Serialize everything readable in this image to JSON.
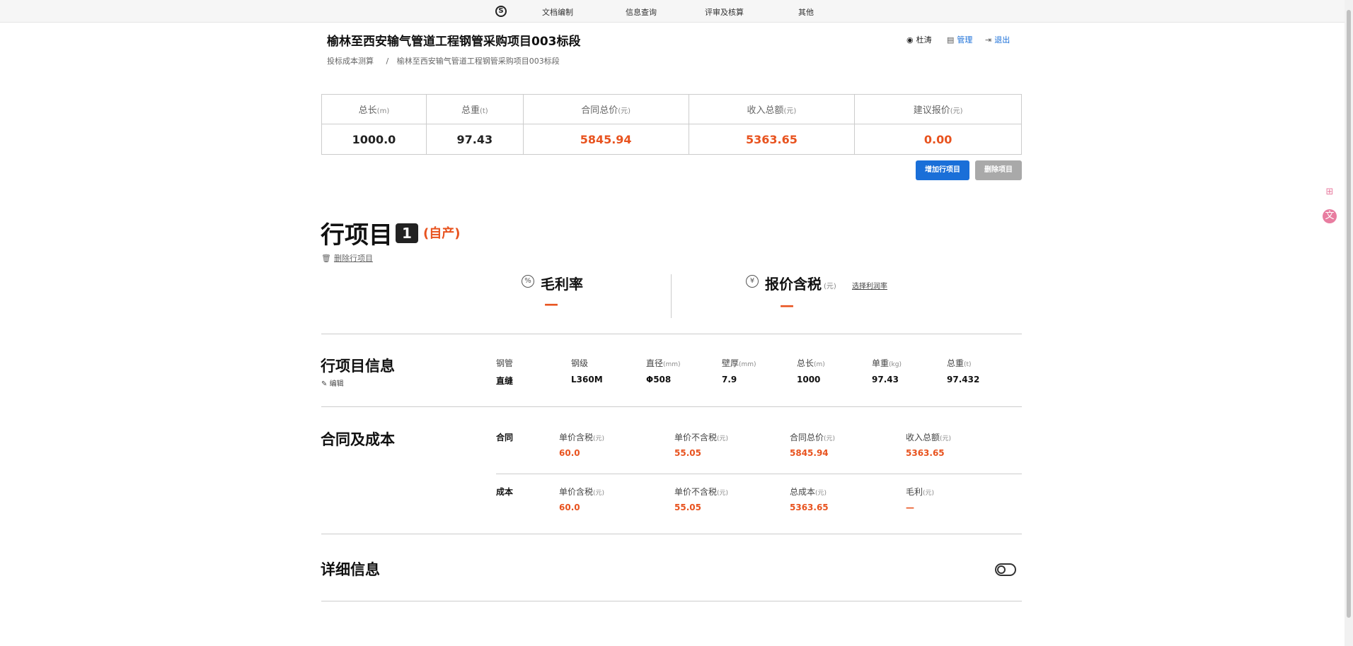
{
  "nav": {
    "logo": "S",
    "items": [
      "文档编制",
      "信息查询",
      "评审及核算",
      "其他"
    ]
  },
  "page": {
    "title": "榆林至西安输气管道工程钢管采购项目003标段",
    "breadcrumb": [
      "投标成本测算",
      "/",
      "榆林至西安输气管道工程钢管采购项目003标段"
    ]
  },
  "user": {
    "name": "杜涛",
    "manage": "管理",
    "logout": "退出"
  },
  "summary": {
    "headers": [
      {
        "label": "总长",
        "unit": "(m)"
      },
      {
        "label": "总重",
        "unit": "(t)"
      },
      {
        "label": "合同总价",
        "unit": "(元)"
      },
      {
        "label": "收入总额",
        "unit": "(元)"
      },
      {
        "label": "建议报价",
        "unit": "(元)"
      }
    ],
    "values": [
      "1000.0",
      "97.43",
      "5845.94",
      "5363.65",
      "0.00"
    ]
  },
  "buttons": {
    "add": "增加行项目",
    "delete": "删除项目"
  },
  "line_item": {
    "title": "行项目",
    "number": "1",
    "tag": "(自产)",
    "delete_label": "删除行项目",
    "gross_margin_label": "毛利率",
    "gross_margin_value": "—",
    "quote_label": "报价含税",
    "quote_unit": "(元)",
    "quote_value": "—",
    "select_rate": "选择利润率"
  },
  "info": {
    "title": "行项目信息",
    "edit": "编辑",
    "fields": [
      {
        "label": "钢管",
        "unit": "",
        "value": "直缝"
      },
      {
        "label": "钢级",
        "unit": "",
        "value": "L360M"
      },
      {
        "label": "直径",
        "unit": "(mm)",
        "value": "Φ508"
      },
      {
        "label": "壁厚",
        "unit": "(mm)",
        "value": "7.9"
      },
      {
        "label": "总长",
        "unit": "(m)",
        "value": "1000"
      },
      {
        "label": "单重",
        "unit": "(kg)",
        "value": "97.43"
      },
      {
        "label": "总重",
        "unit": "(t)",
        "value": "97.432"
      }
    ]
  },
  "contract": {
    "title": "合同及成本",
    "contract_label": "合同",
    "cost_label": "成本",
    "contract_fields": [
      {
        "label": "单价含税",
        "unit": "(元)",
        "value": "60.0"
      },
      {
        "label": "单价不含税",
        "unit": "(元)",
        "value": "55.05"
      },
      {
        "label": "合同总价",
        "unit": "(元)",
        "value": "5845.94"
      },
      {
        "label": "收入总额",
        "unit": "(元)",
        "value": "5363.65"
      }
    ],
    "cost_fields": [
      {
        "label": "单价含税",
        "unit": "(元)",
        "value": "60.0"
      },
      {
        "label": "单价不含税",
        "unit": "(元)",
        "value": "55.05"
      },
      {
        "label": "总成本",
        "unit": "(元)",
        "value": "5363.65"
      },
      {
        "label": "毛利",
        "unit": "(元)",
        "value": "—"
      }
    ]
  },
  "details": {
    "title": "详细信息"
  },
  "colors": {
    "accent_blue": "#1a6fd8",
    "accent_red": "#e8531f",
    "disabled_gray": "#a9a9a9"
  }
}
